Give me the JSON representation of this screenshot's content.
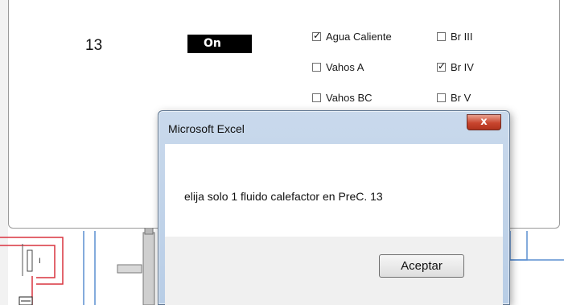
{
  "sheet": {
    "row_number": "13",
    "status_label": "On",
    "checkboxes": [
      {
        "label": "Agua Caliente",
        "checked": true
      },
      {
        "label": "Vahos A",
        "checked": false
      },
      {
        "label": "Vahos BC",
        "checked": false
      },
      {
        "label": "Br III",
        "checked": false
      },
      {
        "label": "Br IV",
        "checked": true
      },
      {
        "label": "Br V",
        "checked": false
      }
    ]
  },
  "dialog": {
    "title": "Microsoft Excel",
    "close_glyph": "x",
    "message": "elija solo 1 fluido calefactor en PreC. 13",
    "ok_label": "Aceptar"
  },
  "colors": {
    "close_button": "#c8452e",
    "dialog_frame": "#b8cde6",
    "diagram_red": "#d9333f",
    "diagram_blue": "#5b8fd1"
  },
  "check_glyph": "✓"
}
